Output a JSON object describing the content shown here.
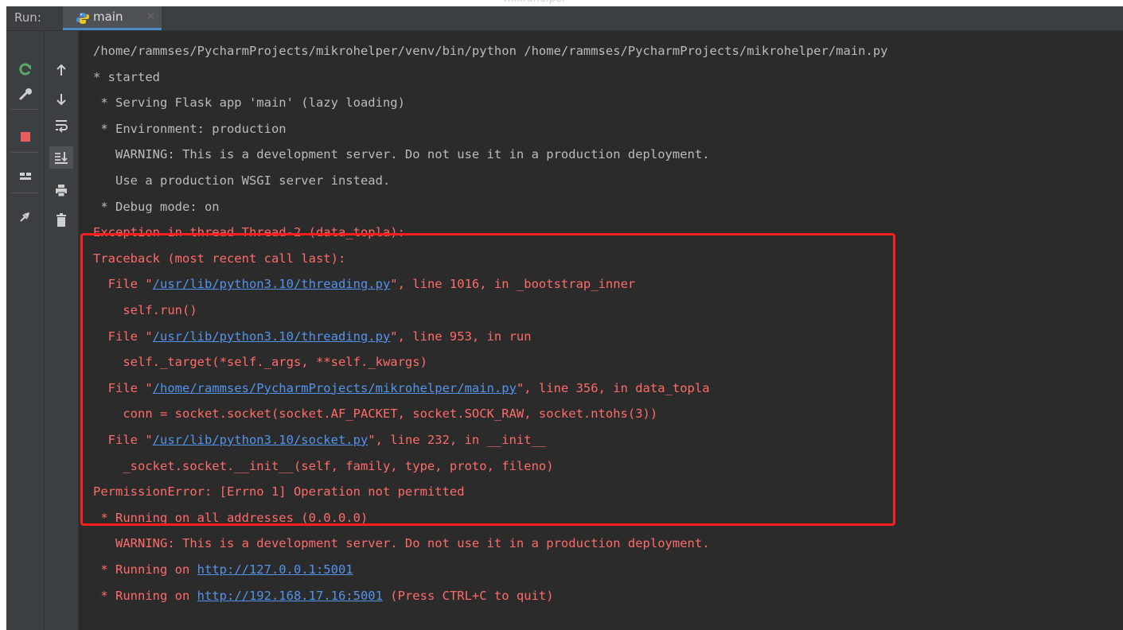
{
  "window": {
    "top_title_partial": "mikrohelper"
  },
  "run_panel": {
    "label": "Run:",
    "tab": {
      "label": "main",
      "close": "×",
      "icon": "python-icon"
    }
  },
  "toolbar": {
    "left": [
      "rerun-icon",
      "wrench-icon",
      "stop-icon",
      "layout-icon",
      "pin-icon"
    ],
    "right": [
      "arrow-up-icon",
      "arrow-down-icon",
      "soft-wrap-icon",
      "scroll-to-end-icon",
      "print-icon",
      "trash-icon"
    ]
  },
  "console": {
    "lines": [
      {
        "type": "plain",
        "text": "/home/rammses/PycharmProjects/mikrohelper/venv/bin/python /home/rammses/PycharmProjects/mikrohelper/main.py"
      },
      {
        "type": "plain",
        "text": "* started"
      },
      {
        "type": "plain",
        "text": " * Serving Flask app 'main' (lazy loading)"
      },
      {
        "type": "plain",
        "text": " * Environment: production"
      },
      {
        "type": "plain",
        "text": "   WARNING: This is a development server. Do not use it in a production deployment."
      },
      {
        "type": "plain",
        "text": "   Use a production WSGI server instead."
      },
      {
        "type": "plain",
        "text": " * Debug mode: on"
      },
      {
        "type": "err",
        "text": "Exception in thread Thread-2 (data_topla):"
      },
      {
        "type": "err",
        "text": "Traceback (most recent call last):"
      },
      {
        "type": "err",
        "pre": "  File \"",
        "link": "/usr/lib/python3.10/threading.py",
        "post": "\", line 1016, in _bootstrap_inner"
      },
      {
        "type": "err",
        "text": "    self.run()"
      },
      {
        "type": "err",
        "pre": "  File \"",
        "link": "/usr/lib/python3.10/threading.py",
        "post": "\", line 953, in run"
      },
      {
        "type": "err",
        "text": "    self._target(*self._args, **self._kwargs)"
      },
      {
        "type": "err",
        "pre": "  File \"",
        "link": "/home/rammses/PycharmProjects/mikrohelper/main.py",
        "post": "\", line 356, in data_topla"
      },
      {
        "type": "err",
        "text": "    conn = socket.socket(socket.AF_PACKET, socket.SOCK_RAW, socket.ntohs(3))"
      },
      {
        "type": "err",
        "pre": "  File \"",
        "link": "/usr/lib/python3.10/socket.py",
        "post": "\", line 232, in __init__"
      },
      {
        "type": "err",
        "text": "    _socket.socket.__init__(self, family, type, proto, fileno)"
      },
      {
        "type": "err",
        "text": "PermissionError: [Errno 1] Operation not permitted"
      },
      {
        "type": "err",
        "text": " * Running on all addresses (0.0.0.0)"
      },
      {
        "type": "err",
        "text": "   WARNING: This is a development server. Do not use it in a production deployment."
      },
      {
        "type": "err",
        "pre": " * Running on ",
        "link": "http://127.0.0.1:5001",
        "post": ""
      },
      {
        "type": "err",
        "pre": " * Running on ",
        "link": "http://192.168.17.16:5001",
        "post": " (Press CTRL+C to quit)"
      }
    ]
  },
  "colors": {
    "background": "#2b2b2b",
    "plain_text": "#bbbbbb",
    "error_text": "#ff6b68",
    "link": "#5394ec",
    "highlight_border": "#ff1f1f"
  }
}
